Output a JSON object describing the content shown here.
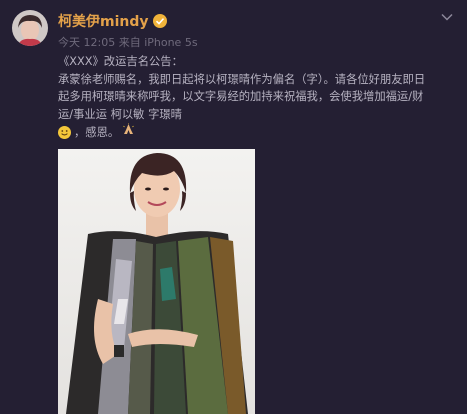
{
  "post": {
    "username": "柯美伊mindy",
    "meta": "今天 12:05 来自 iPhone 5s",
    "lines": [
      "《XXX》改运吉名公告：",
      "承蒙徐老师赐名，我即日起将以柯璟晴作为偏名（字）。请各位好朋友即日",
      "起多用柯璟晴来称呼我，以文字易经的加持来祝福我，会使我增加福运/财",
      "运/事业运 柯以敏 字璟晴"
    ],
    "emoji_suffix": "，感恩。",
    "icons": {
      "avatar": "avatar-portrait",
      "verified": "verified-badge-icon",
      "more": "chevron-down-icon",
      "smile": "smile-emoji-icon",
      "pray": "pray-emoji-icon"
    },
    "photo": {
      "name": "post-photo"
    }
  },
  "colors": {
    "background": "#241f33",
    "username": "#e3a14a",
    "text": "#b7b3c2",
    "meta": "#6f6a7c"
  }
}
